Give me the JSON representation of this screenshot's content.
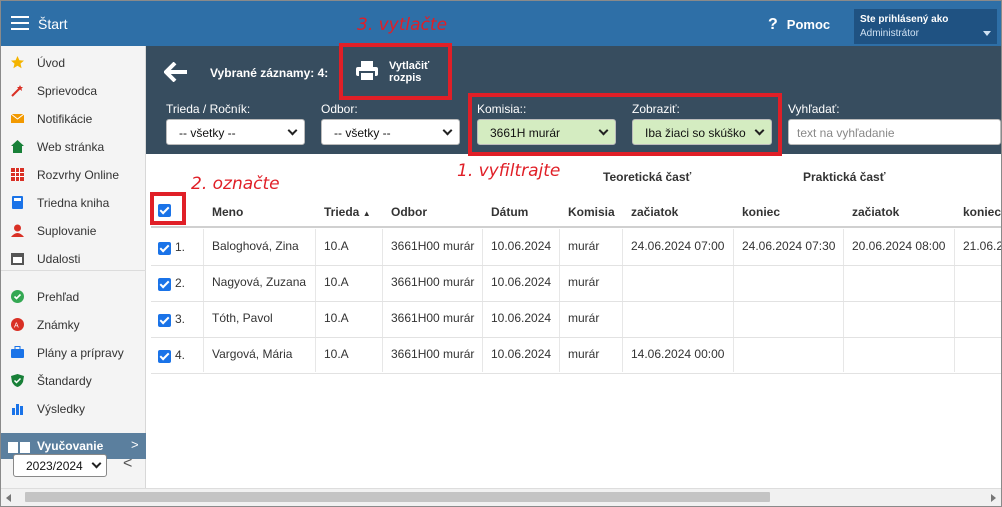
{
  "app": {
    "title": "Štart"
  },
  "header": {
    "help_label": "Pomoc",
    "user_line1": "Ste prihlásený ako",
    "user_line2": "Administrátor"
  },
  "sidebar": {
    "items": [
      {
        "label": "Úvod",
        "icon": "star-icon",
        "color": "#f4b400"
      },
      {
        "label": "Sprievodca",
        "icon": "wand-icon",
        "color": "#d93025"
      },
      {
        "label": "Notifikácie",
        "icon": "envelope-icon",
        "color": "#f29900"
      },
      {
        "label": "Web stránka",
        "icon": "home-icon",
        "color": "#188038"
      },
      {
        "label": "Rozvrhy Online",
        "icon": "timetable-icon",
        "color": "#d93025"
      },
      {
        "label": "Triedna kniha",
        "icon": "book-icon",
        "color": "#1a73e8"
      },
      {
        "label": "Suplovanie",
        "icon": "person-icon",
        "color": "#d93025"
      },
      {
        "label": "Udalosti",
        "icon": "calendar-icon",
        "color": "#555555"
      },
      {
        "label": "Prehľad",
        "icon": "check-circle-icon",
        "color": "#34a853"
      },
      {
        "label": "Známky",
        "icon": "grades-icon",
        "color": "#d93025"
      },
      {
        "label": "Plány a prípravy",
        "icon": "briefcase-icon",
        "color": "#1a73e8"
      },
      {
        "label": "Štandardy",
        "icon": "shield-icon",
        "color": "#188038"
      },
      {
        "label": "Výsledky",
        "icon": "bar-chart-icon",
        "color": "#1a73e8"
      }
    ],
    "section_label": "Vyučovanie",
    "year_value": "2023/2024"
  },
  "toolbar": {
    "selected_label": "Vybrané záznamy: 4:",
    "print_line1": "Vytlačiť",
    "print_line2": "rozpis"
  },
  "filters": {
    "trieda_label": "Trieda / Ročník:",
    "trieda_value": "-- všetky --",
    "odbor_label": "Odbor:",
    "odbor_value": "-- všetky --",
    "komisia_label": "Komisia::",
    "komisia_value": "3661H murár",
    "zobrazit_label": "Zobraziť:",
    "zobrazit_value": "Iba žiaci so skúško",
    "search_label": "Vyhľadať:",
    "search_placeholder": "text na vyhľadanie"
  },
  "table": {
    "group_theory": "Teoretická časť",
    "group_practice": "Praktická časť",
    "headers": {
      "meno": "Meno",
      "trieda": "Trieda",
      "odbor": "Odbor",
      "datum": "Dátum",
      "komisia": "Komisia",
      "t_start": "začiatok",
      "t_end": "koniec",
      "p_start": "začiatok",
      "p_end": "koniec"
    },
    "rows": [
      {
        "num": "1.",
        "meno": "Baloghová, Zina",
        "trieda": "10.A",
        "odbor": "3661H00 murár",
        "datum": "10.06.2024",
        "komisia": "murár",
        "t_start": "24.06.2024 07:00",
        "t_end": "24.06.2024 07:30",
        "p_start": "20.06.2024 08:00",
        "p_end": "21.06.2"
      },
      {
        "num": "2.",
        "meno": "Nagyová, Zuzana",
        "trieda": "10.A",
        "odbor": "3661H00 murár",
        "datum": "10.06.2024",
        "komisia": "murár",
        "t_start": "",
        "t_end": "",
        "p_start": "",
        "p_end": ""
      },
      {
        "num": "3.",
        "meno": "Tóth, Pavol",
        "trieda": "10.A",
        "odbor": "3661H00 murár",
        "datum": "10.06.2024",
        "komisia": "murár",
        "t_start": "",
        "t_end": "",
        "p_start": "",
        "p_end": ""
      },
      {
        "num": "4.",
        "meno": "Vargová, Mária",
        "trieda": "10.A",
        "odbor": "3661H00 murár",
        "datum": "10.06.2024",
        "komisia": "murár",
        "t_start": "14.06.2024 00:00",
        "t_end": "",
        "p_start": "",
        "p_end": ""
      }
    ]
  },
  "annotations": {
    "step1": "1. vyfiltrajte",
    "step2": "2. označte",
    "step3": "3. vytlačte",
    "color": "#e01f27"
  }
}
